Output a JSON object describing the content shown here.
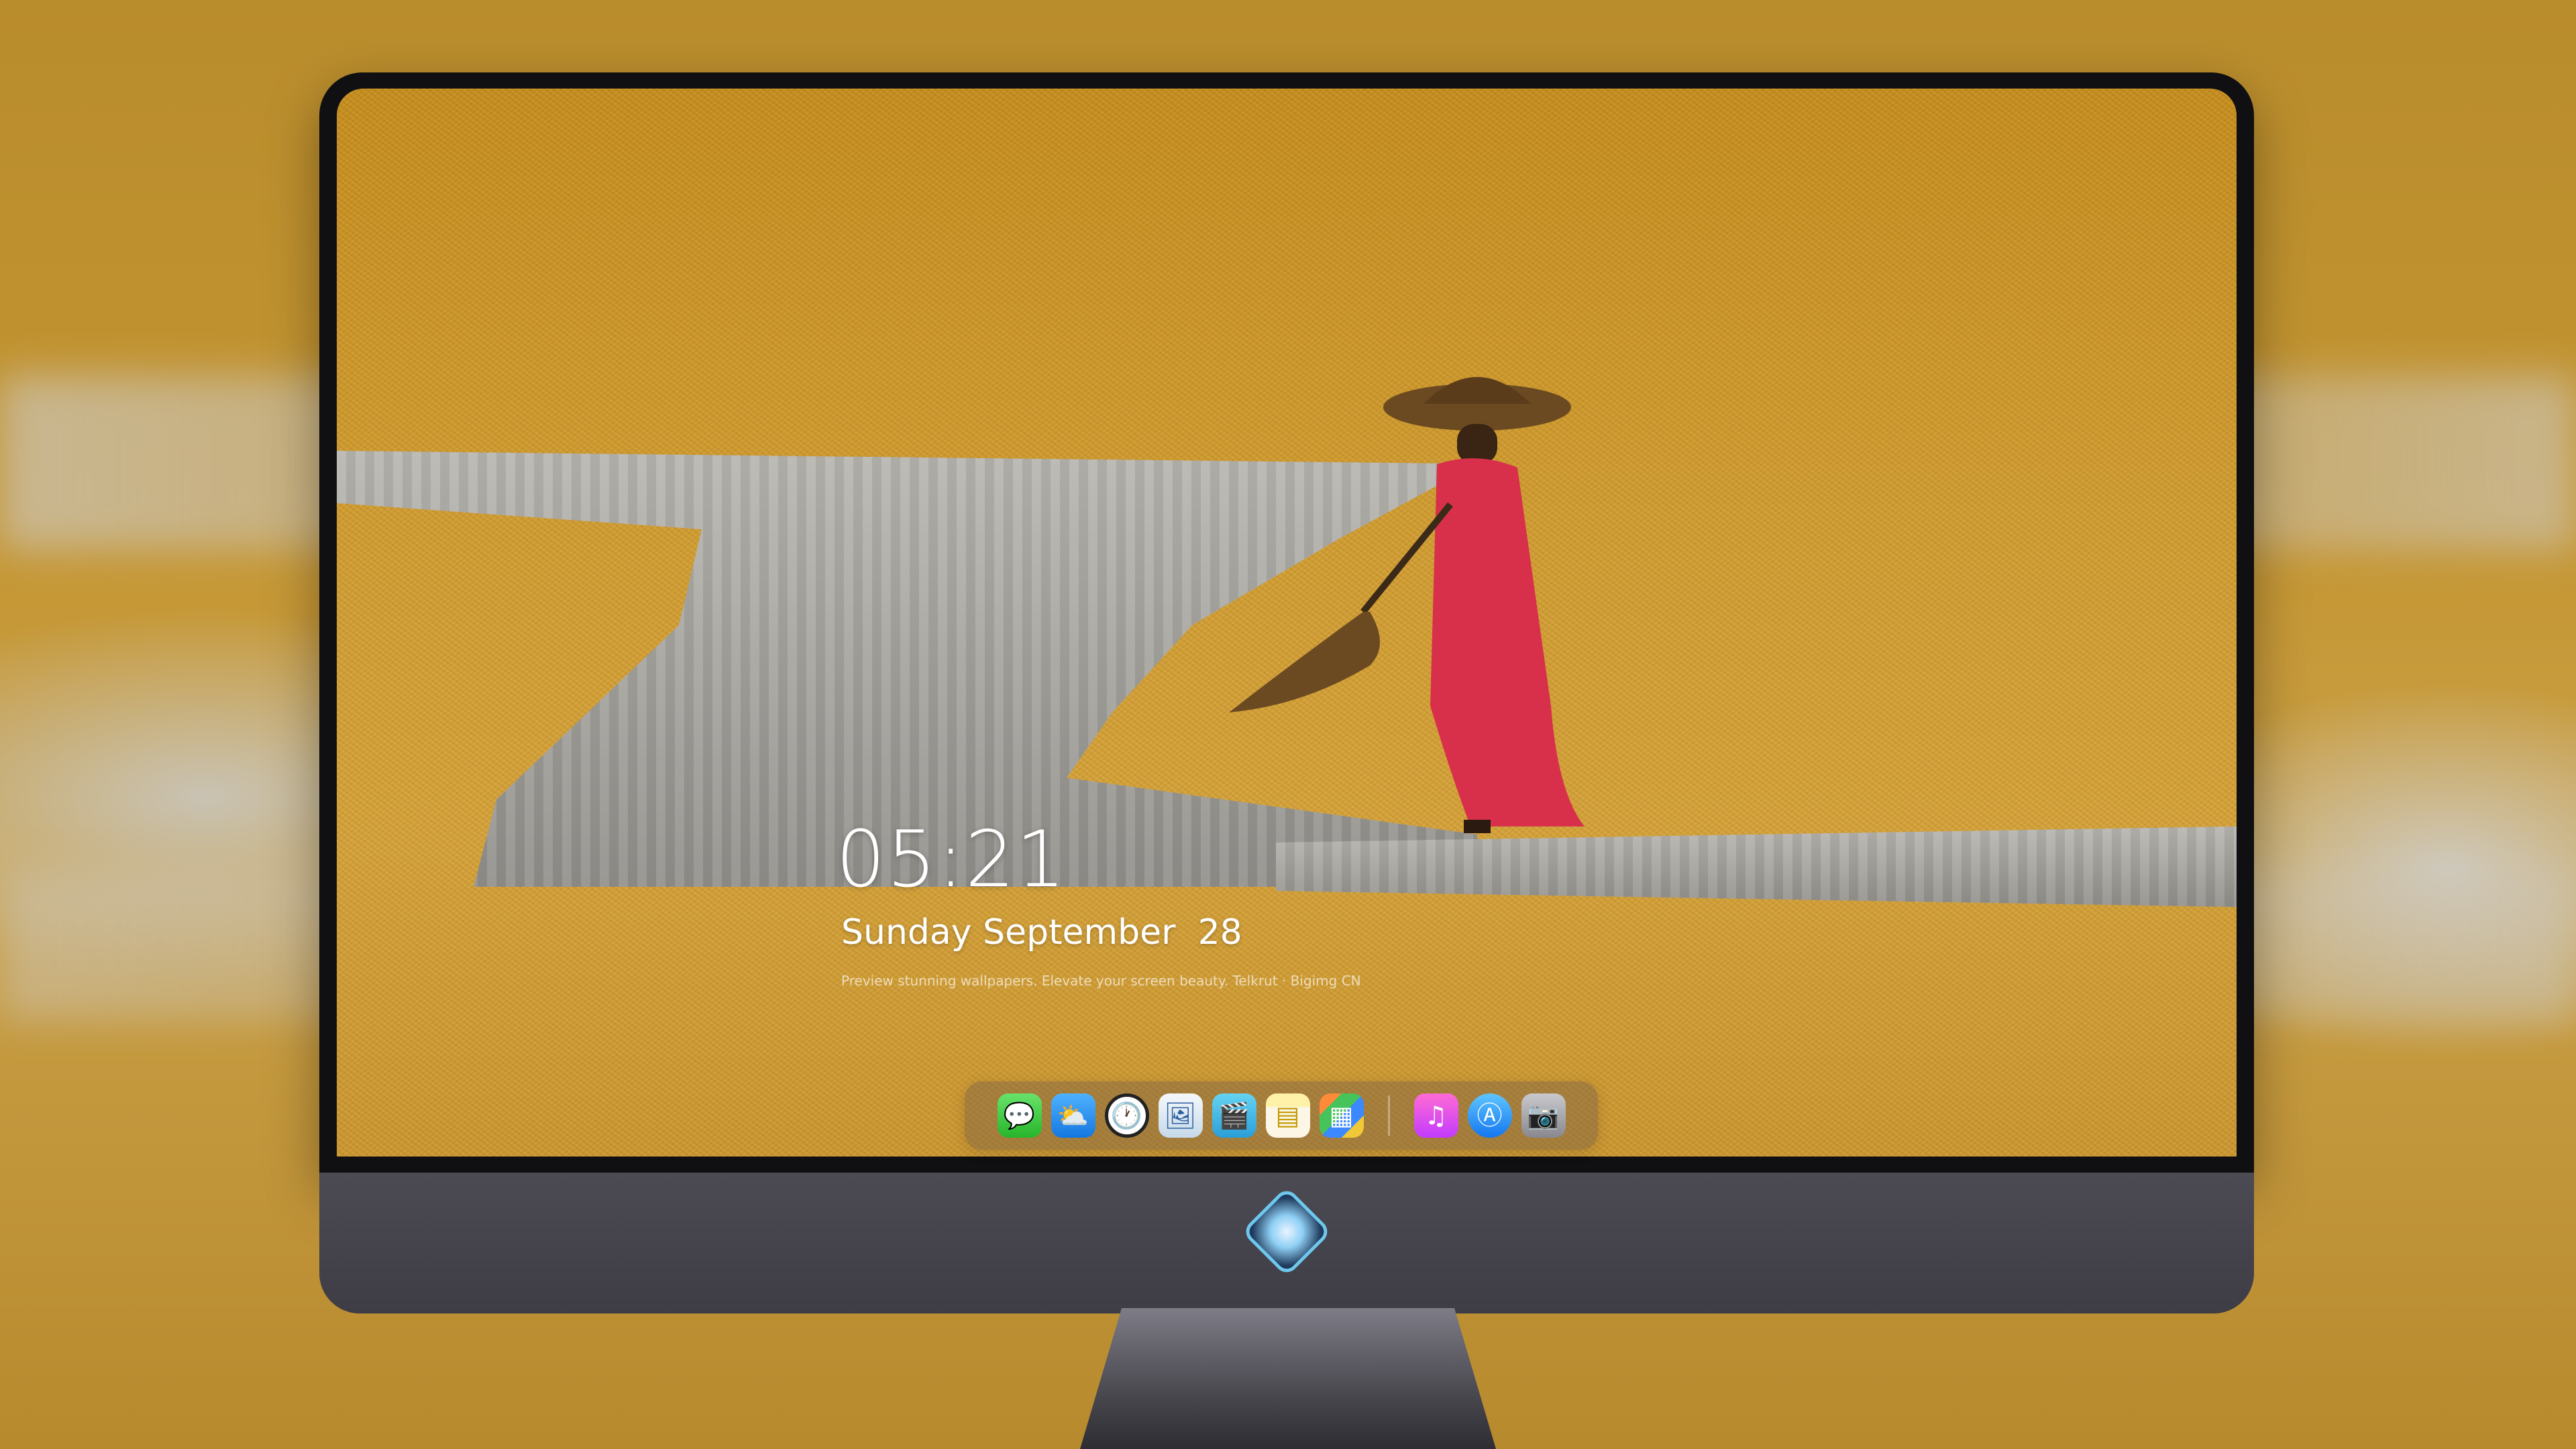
{
  "lockscreen": {
    "time": "05:21",
    "date": "Sunday September  28",
    "caption": "Preview stunning wallpapers. Elevate your screen beauty. Telkrut · Bigimg CN"
  },
  "dock": {
    "apps": [
      {
        "name": "messages",
        "glyph": "💬"
      },
      {
        "name": "weather",
        "glyph": "⛅"
      },
      {
        "name": "clock",
        "glyph": "🕐"
      },
      {
        "name": "preview",
        "glyph": "🖼"
      },
      {
        "name": "clips",
        "glyph": "🎬"
      },
      {
        "name": "notes",
        "glyph": "▤"
      },
      {
        "name": "photos",
        "glyph": "▦"
      },
      {
        "name": "music",
        "glyph": "♫"
      },
      {
        "name": "app-store",
        "glyph": "Ⓐ"
      },
      {
        "name": "camera",
        "glyph": "📷"
      }
    ]
  },
  "colors": {
    "wallpaper_gold": "#cf9b31",
    "bezel": "#101012",
    "chin": "#46454d"
  }
}
